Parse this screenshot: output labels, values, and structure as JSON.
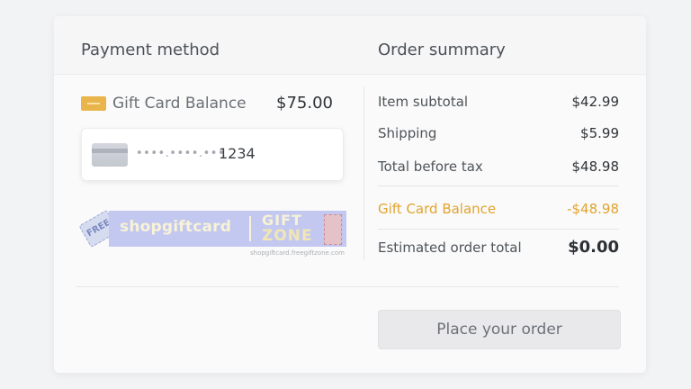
{
  "payment_method": {
    "title": "Payment method",
    "gift_card": {
      "label": "Gift Card  Balance",
      "amount": "$75.00",
      "icon": "gift-card-icon",
      "icon_color": "#e9b54a"
    },
    "saved_card": {
      "masked": "••••.••••.•••",
      "last4": "1234",
      "icon": "credit-card-icon"
    },
    "promo_banner": {
      "free_tag": "FREE",
      "brand": "shopgiftcard",
      "gift": "GIFT",
      "zone": "ZONE",
      "url": "shopgiftcard.freegiftzone.com",
      "color": "#c3c8f0"
    }
  },
  "order_summary": {
    "title": "Order summary",
    "rows": [
      {
        "label": "Item subtotal",
        "value": "$42.99"
      },
      {
        "label": "Shipping",
        "value": "$5.99"
      },
      {
        "label": "Total before tax",
        "value": "$48.98"
      },
      {
        "label": "Gift Card Balance",
        "value": "-$48.98"
      },
      {
        "label": "Estimated order total",
        "value": "$0.00"
      }
    ],
    "accent_color": "#e1a32f"
  },
  "actions": {
    "place_order": "Place your order"
  }
}
